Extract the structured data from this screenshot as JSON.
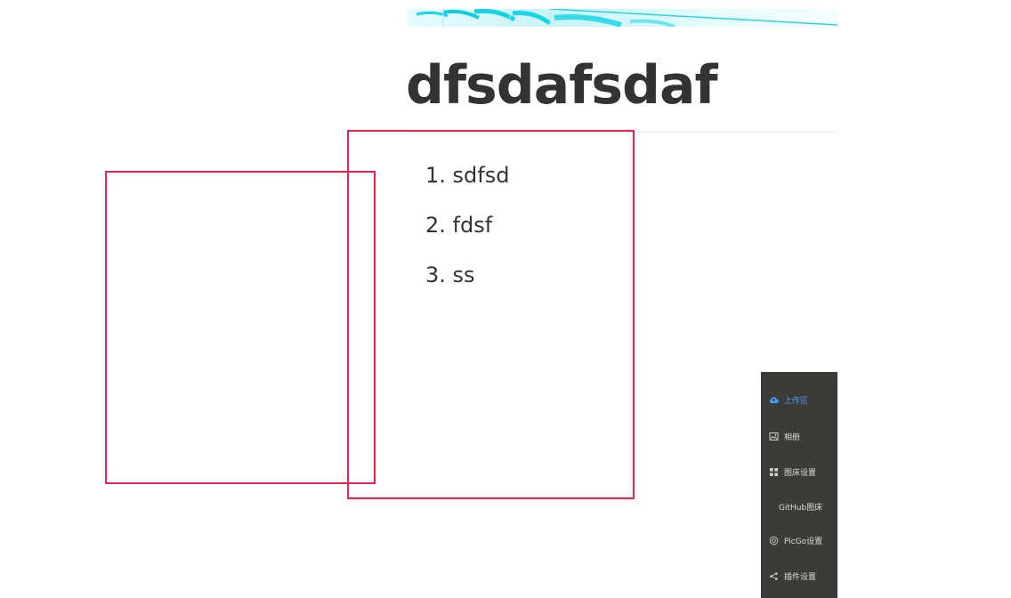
{
  "document": {
    "title": "dfsdafsdaf",
    "list_items": [
      "1. sdfsd",
      "2. fdsf",
      "3. ss"
    ]
  },
  "side_menu": {
    "active_color": "#409eff",
    "background": "#3d3b38",
    "items": [
      {
        "label": "上传区",
        "icon": "upload-cloud-icon",
        "active": true
      },
      {
        "label": "相册",
        "icon": "album-icon",
        "active": false
      },
      {
        "label": "图床设置",
        "icon": "grid-icon",
        "active": false
      },
      {
        "label": "GitHub图床",
        "icon": "",
        "active": false
      },
      {
        "label": "PicGo设置",
        "icon": "settings-circle-icon",
        "active": false
      },
      {
        "label": "插件设置",
        "icon": "share-icon",
        "active": false
      }
    ]
  },
  "annotation": {
    "box_color": "#e8234f"
  }
}
